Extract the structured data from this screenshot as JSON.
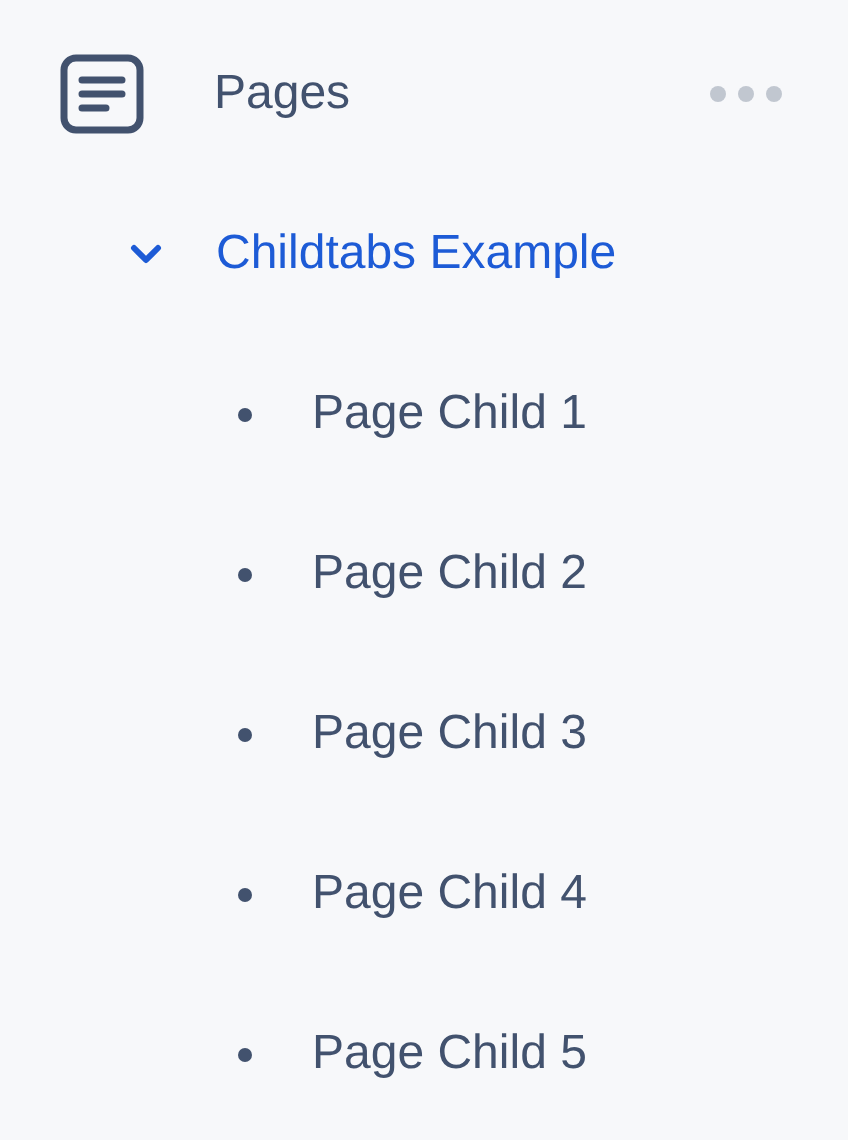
{
  "sidebar": {
    "title": "Pages",
    "items": [
      {
        "label": "Childtabs Example",
        "selected": true,
        "expanded": true,
        "children": [
          {
            "label": "Page Child 1",
            "selected": false
          },
          {
            "label": "Page Child 2",
            "selected": false
          },
          {
            "label": "Page Child 3",
            "selected": false
          },
          {
            "label": "Page Child 4",
            "selected": false
          },
          {
            "label": "Page Child 5",
            "selected": false
          }
        ]
      }
    ]
  }
}
